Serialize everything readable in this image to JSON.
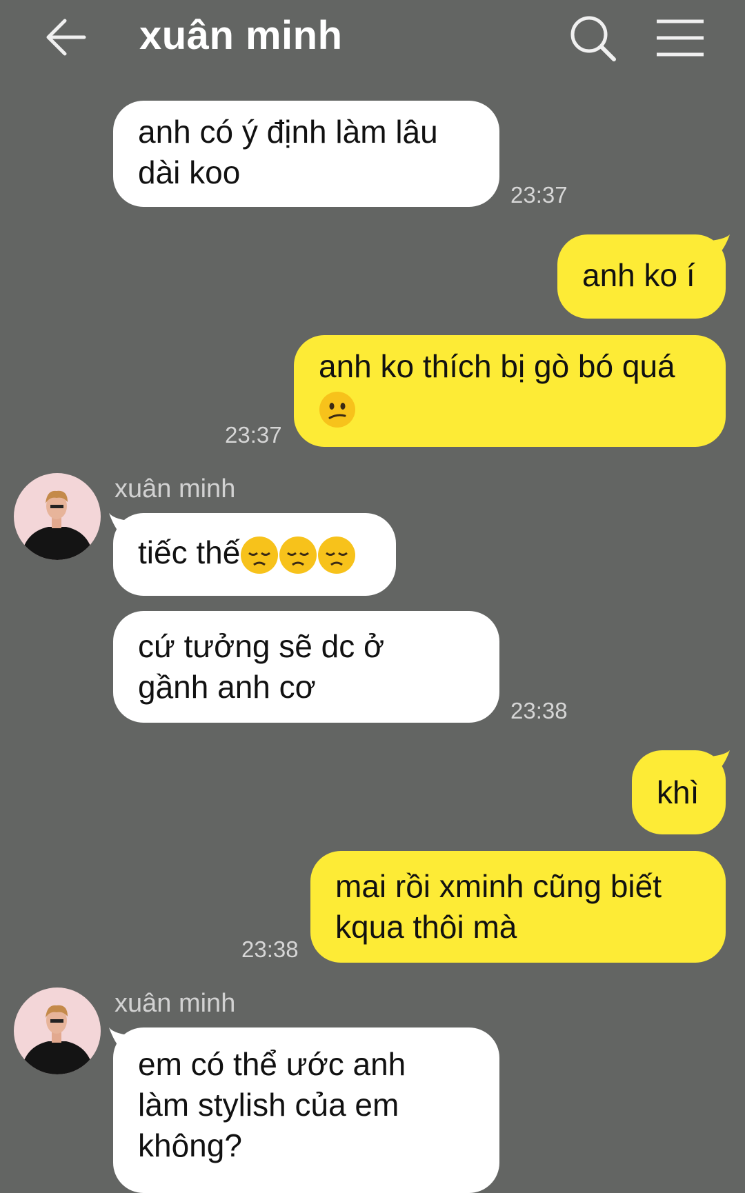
{
  "header": {
    "title": "xuân minh",
    "back_icon": "arrow-left-icon",
    "search_icon": "search-icon",
    "menu_icon": "hamburger-menu-icon"
  },
  "colors": {
    "background": "#636563",
    "incoming_bubble": "#ffffff",
    "outgoing_bubble": "#fdeb36"
  },
  "messages": [
    {
      "direction": "in",
      "lines": [
        "anh có ý định làm lâu",
        "dài koo"
      ],
      "time": "23:37"
    },
    {
      "direction": "out",
      "lines": [
        "anh ko í"
      ]
    },
    {
      "direction": "out",
      "lines": [
        "anh ko thích bị gò bó quá"
      ],
      "emoji": "confused-face",
      "time": "23:37"
    },
    {
      "direction": "in",
      "sender": "xuân minh",
      "lines": [
        "tiếc thế"
      ],
      "emoji": "disappointed-face x3"
    },
    {
      "direction": "in",
      "lines": [
        "cứ tưởng sẽ dc ở",
        "gầnh anh cơ"
      ],
      "time": "23:38"
    },
    {
      "direction": "out",
      "lines": [
        "khì"
      ]
    },
    {
      "direction": "out",
      "lines": [
        "mai rồi xminh cũng biết",
        "kqua thôi mà"
      ],
      "time": "23:38"
    },
    {
      "direction": "in",
      "sender": "xuân minh",
      "lines": [
        "em có thể ước anh",
        "làm stylish của em",
        "không?"
      ]
    }
  ]
}
